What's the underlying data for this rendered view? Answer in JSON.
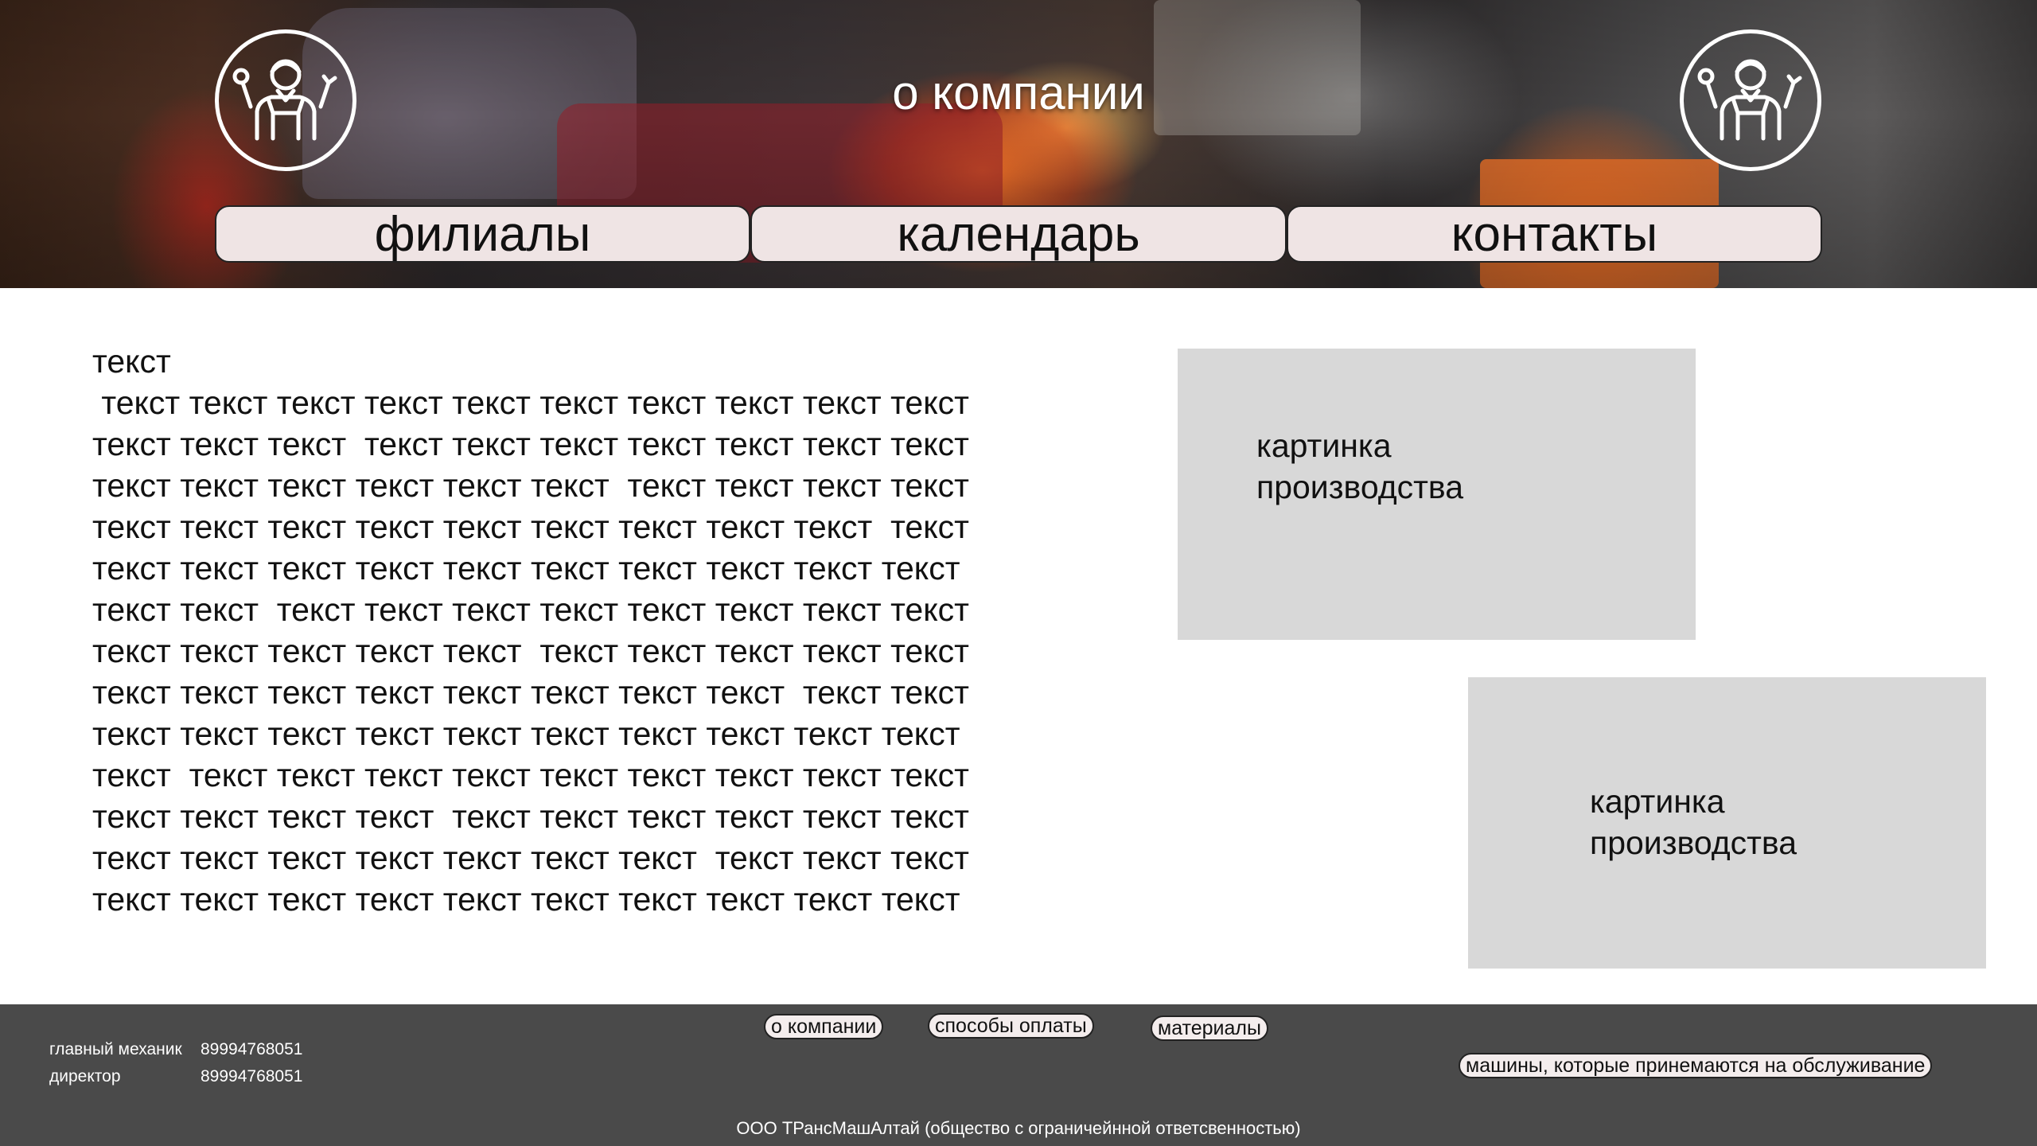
{
  "header": {
    "title": "о компании",
    "logo_icon": "mechanic-icon",
    "nav": [
      {
        "label": "филиалы"
      },
      {
        "label": "календарь"
      },
      {
        "label": "контакты"
      }
    ]
  },
  "main": {
    "text_lines": [
      "текст",
      " текст текст текст текст текст текст текст текст текст текст",
      "текст текст текст  текст текст текст текст текст текст текст",
      "текст текст текст текст текст текст  текст текст текст текст",
      "текст текст текст текст текст текст текст текст текст  текст",
      "текст текст текст текст текст текст текст текст текст текст",
      "текст текст  текст текст текст текст текст текст текст текст",
      "текст текст текст текст текст  текст текст текст текст текст",
      "текст текст текст текст текст текст текст текст  текст текст",
      "текст текст текст текст текст текст текст текст текст текст",
      "текст  текст текст текст текст текст текст текст текст текст",
      "текст текст текст текст  текст текст текст текст текст текст",
      "текст текст текст текст текст текст текст  текст текст текст",
      "текст текст текст текст текст текст текст текст текст текст"
    ],
    "pictures": [
      {
        "line1": "картинка",
        "line2": "производства"
      },
      {
        "line1": "картинка",
        "line2": "производства"
      }
    ]
  },
  "footer": {
    "contacts": [
      {
        "role": "главный механик",
        "phone": "89994768051"
      },
      {
        "role": "директор",
        "phone": "89994768051"
      }
    ],
    "links": [
      {
        "label": "о компании"
      },
      {
        "label": "способы оплаты"
      },
      {
        "label": "материалы"
      },
      {
        "label": "машины, которые принемаются на обслуживание"
      }
    ],
    "legal": "ООО ТРансМашАлтай (общество с ограничейнной ответсвенностью)"
  }
}
